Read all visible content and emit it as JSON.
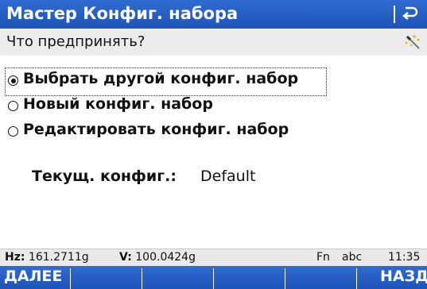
{
  "window": {
    "title": "Мастер Конфиг. набора",
    "back_icon": "return-arrow-icon"
  },
  "prompt": {
    "text": "Что предпринять?",
    "icon": "wand-icon"
  },
  "options": [
    {
      "label": "Выбрать другой конфиг. набор",
      "selected": true
    },
    {
      "label": "Новый конфиг. набор",
      "selected": false
    },
    {
      "label": "Редактировать конфиг. набор",
      "selected": false
    }
  ],
  "current_config": {
    "label": "Текущ. конфиг.:",
    "value": "Default"
  },
  "status": {
    "hz_label": "Hz:",
    "hz_value": "161.2711g",
    "v_label": "V:",
    "v_value": "100.0424g",
    "fn": "Fn",
    "input_mode": "abc",
    "time": "11:35"
  },
  "softkeys": {
    "f1": "ДАЛЕЕ",
    "f2": "",
    "f3": "",
    "f4": "",
    "f5": "",
    "f6": "НАЗД"
  },
  "colors": {
    "bar_blue": "#1d54b8",
    "prompt_bg": "#ececec",
    "status_bg": "#e9e9e9"
  }
}
